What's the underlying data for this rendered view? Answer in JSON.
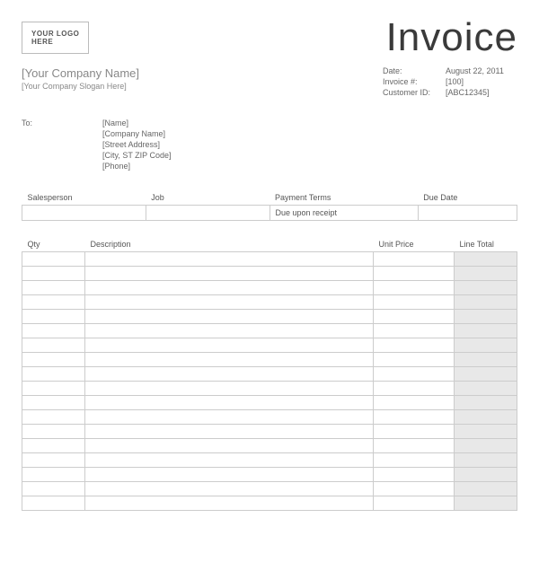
{
  "logo_text": "YOUR LOGO\nHERE",
  "title": "Invoice",
  "company": {
    "name": "[Your Company Name]",
    "slogan": "[Your Company Slogan Here]"
  },
  "meta": {
    "date_label": "Date:",
    "date_value": "August 22, 2011",
    "invoice_label": "Invoice #:",
    "invoice_value": "[100]",
    "customer_label": "Customer ID:",
    "customer_value": "[ABC12345]"
  },
  "to": {
    "label": "To:",
    "name": "[Name]",
    "company": "[Company Name]",
    "street": "[Street Address]",
    "city": "[City, ST  ZIP Code]",
    "phone": "[Phone]"
  },
  "terms": {
    "salesperson_label": "Salesperson",
    "salesperson_value": "",
    "job_label": "Job",
    "job_value": "",
    "payment_label": "Payment Terms",
    "payment_value": "Due upon receipt",
    "due_label": "Due Date",
    "due_value": ""
  },
  "items_header": {
    "qty": "Qty",
    "description": "Description",
    "unit_price": "Unit Price",
    "line_total": "Line Total"
  }
}
